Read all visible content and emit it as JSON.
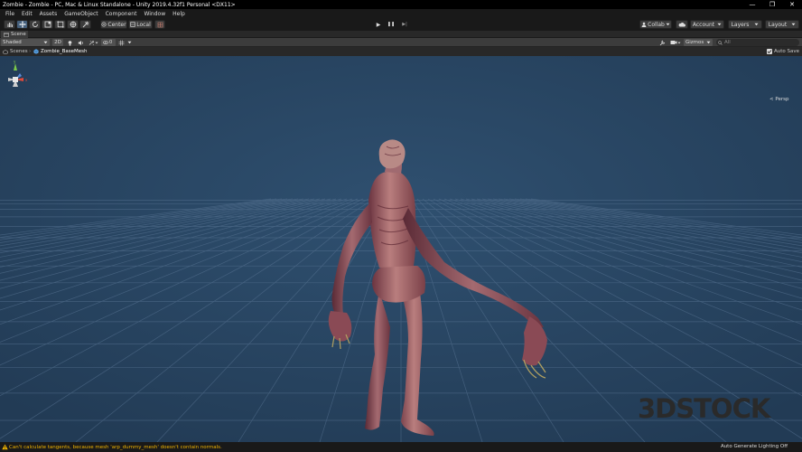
{
  "window": {
    "title": "Zombie - Zombie - PC, Mac & Linux Standalone - Unity 2019.4.32f1 Personal <DX11>",
    "minimize_glyph": "—",
    "restore_glyph": "❐",
    "close_glyph": "✕"
  },
  "menu": [
    "File",
    "Edit",
    "Assets",
    "GameObject",
    "Component",
    "Window",
    "Help"
  ],
  "toolbar": {
    "tools": [
      "hand-tool-icon",
      "move-tool-icon",
      "rotate-tool-icon",
      "scale-tool-icon",
      "rect-tool-icon",
      "transform-tool-icon",
      "custom-tool-icon"
    ],
    "pivot_label": "Center",
    "space_label": "Local",
    "play_glyph": "▶",
    "pause_glyph": "❚❚",
    "step_glyph": "▶|",
    "collab_label": "Collab",
    "account_label": "Account",
    "layers_label": "Layers",
    "layout_label": "Layout"
  },
  "scene_tab": {
    "label": "Scene"
  },
  "scene_options": {
    "draw_mode": "Shaded",
    "mode_2d": "2D",
    "gizmos_label": "Gizmos",
    "search_all": "All"
  },
  "breadcrumb": {
    "root": "Scenes",
    "current": "Zombie_BaseMesh",
    "auto_save": "Auto Save"
  },
  "viewport": {
    "persp_label": "< Persp",
    "bg_color": "#284460",
    "grid_color": "#5b7796"
  },
  "watermark": {
    "text": "3DSTOCK"
  },
  "status": {
    "message": "Can't calculate tangents, because mesh 'arp_dummy_mesh' doesn't contain normals.",
    "right": "Auto Generate Lighting Off"
  }
}
